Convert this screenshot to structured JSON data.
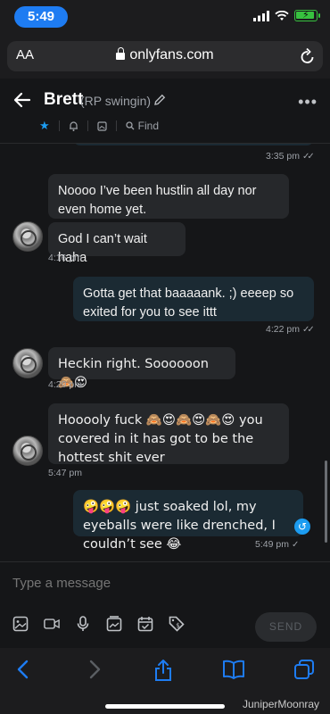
{
  "status": {
    "time": "5:49"
  },
  "browser": {
    "aa_label": "AA",
    "url": "onlyfans.com"
  },
  "chat": {
    "name": "Brett",
    "note": "(RP swingin)",
    "find_label": "Find"
  },
  "messages": [
    {
      "direction": "out",
      "time": "3:35 pm",
      "status": "read"
    },
    {
      "direction": "in",
      "text": "Noooo I’ve been hustlin all day nor even home yet."
    },
    {
      "direction": "in",
      "text": "God I can’t wait haha",
      "time": "4:16 pm"
    },
    {
      "direction": "out",
      "text": "Gotta get that baaaaank. ;) eeeep so exited for you to see ittt",
      "time": "4:22 pm",
      "status": "read"
    },
    {
      "direction": "in",
      "text": "Heckin right. Soooooon 🙈😍",
      "time": "4:29 pm"
    },
    {
      "direction": "in",
      "text": "Hooooly fuck 🙈😍🙈😍🙈😍 you covered in it has got to be the hottest shit ever",
      "time": "5:47 pm"
    },
    {
      "direction": "out",
      "text": "🤪🤪🤪 just soaked lol, my eyeballs were like drenched, I couldn’t see 😂",
      "time": "5:49 pm",
      "status": "sent"
    }
  ],
  "composer": {
    "placeholder": "Type a message",
    "send_label": "SEND",
    "tools": [
      "image-icon",
      "video-icon",
      "microphone-icon",
      "vault-icon",
      "schedule-icon",
      "price-tag-icon"
    ]
  },
  "watermark": "JuniperMoonray",
  "colors": {
    "accent": "#1c9cf0",
    "incoming_bubble": "#26282b",
    "outgoing_bubble": "#1b2a33",
    "status_time_pill": "#1e7cf2"
  }
}
